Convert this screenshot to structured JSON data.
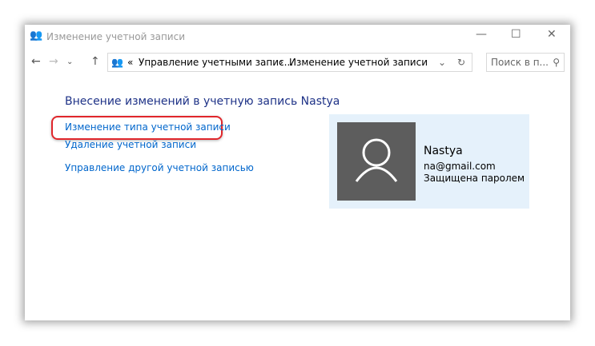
{
  "window": {
    "title": "Изменение учетной записи",
    "minimize": "—",
    "maximize": "☐",
    "close": "✕"
  },
  "address": {
    "prefix": "«",
    "crumb1": "Управление учетными запис...",
    "sep": "›",
    "crumb2": "Изменение учетной записи"
  },
  "search": {
    "placeholder": "Поиск в п..."
  },
  "main": {
    "heading": "Внесение изменений в учетную запись Nastya",
    "links": [
      "Изменение типа учетной записи",
      "Удаление учетной записи",
      "Управление другой учетной записью"
    ]
  },
  "user": {
    "name": "Nastya",
    "email": "na@gmail.com",
    "status": "Защищена паролем"
  }
}
